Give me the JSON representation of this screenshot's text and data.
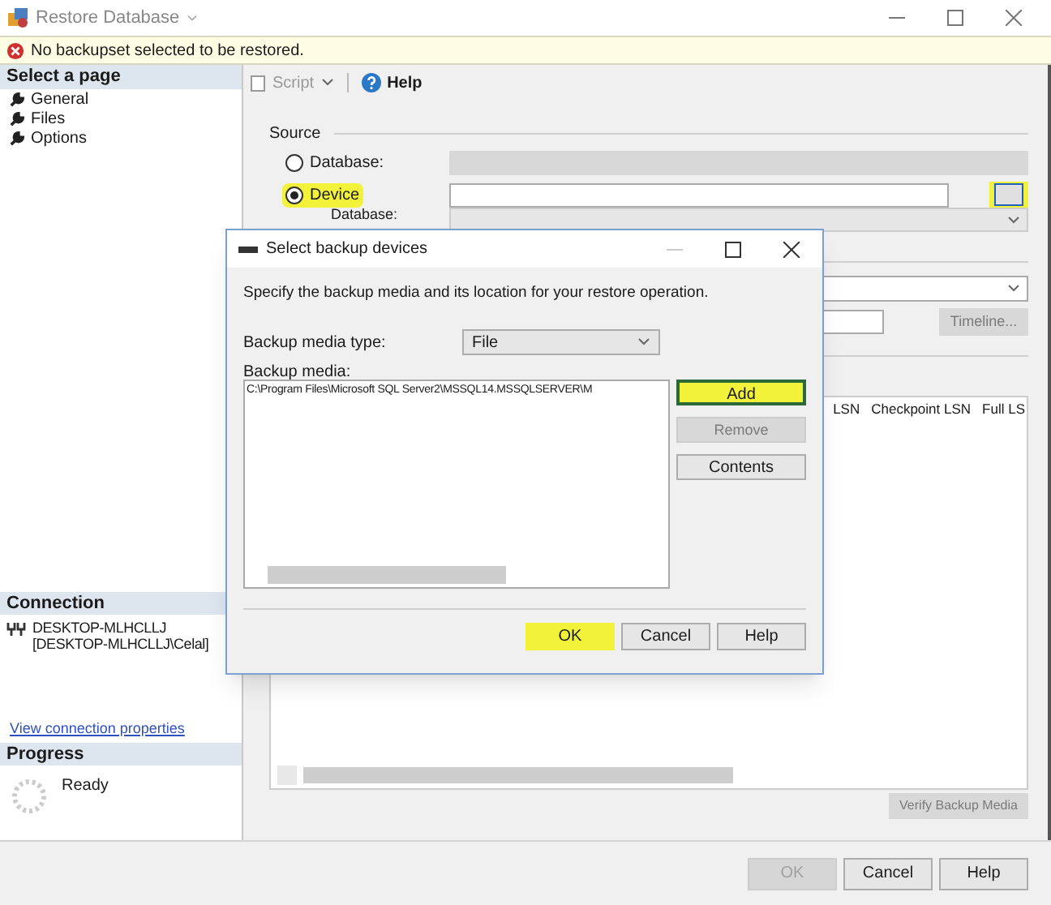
{
  "window": {
    "title": "Restore Database"
  },
  "error": {
    "message": "No backupset selected to be restored."
  },
  "sidebar": {
    "select_page": {
      "header": "Select a page",
      "items": [
        {
          "label": "General"
        },
        {
          "label": "Files"
        },
        {
          "label": "Options"
        }
      ]
    },
    "connection": {
      "header": "Connection",
      "server": "DESKTOP-MLHCLLJ",
      "user": "[DESKTOP-MLHCLLJ\\Celal]",
      "link": "View connection properties"
    },
    "progress": {
      "header": "Progress",
      "status": "Ready"
    }
  },
  "toolbar": {
    "script": "Script",
    "help": "Help"
  },
  "source": {
    "label": "Source",
    "options": [
      {
        "label": "Database:",
        "selected": false,
        "highlighted": false
      },
      {
        "label": "Device",
        "selected": true,
        "highlighted": true
      }
    ],
    "browse_highlighted": true,
    "database_label": "Database:"
  },
  "destination": {
    "timeline": "Timeline..."
  },
  "backup_sets": {
    "columns": [
      "LSN",
      "Checkpoint LSN",
      "Full LS"
    ],
    "verify": "Verify Backup Media"
  },
  "buttons": [
    {
      "label": "OK",
      "disabled": true
    },
    {
      "label": "Cancel",
      "disabled": false
    },
    {
      "label": "Help",
      "disabled": false
    }
  ],
  "dialog": {
    "title": "Select backup devices",
    "description": "Specify the backup media and its location for your restore operation.",
    "media_type_label": "Backup media type:",
    "media_type": "File",
    "media_label": "Backup media:",
    "media": [
      "C:\\Program Files\\Microsoft SQL Server2\\MSSQL14.MSSQLSERVER\\M"
    ],
    "side_buttons": [
      {
        "label": "Add",
        "disabled": false,
        "highlighted": true
      },
      {
        "label": "Remove",
        "disabled": true,
        "highlighted": false
      },
      {
        "label": "Contents",
        "disabled": false,
        "highlighted": false
      }
    ],
    "buttons": [
      {
        "label": "OK",
        "highlighted": true
      },
      {
        "label": "Cancel",
        "highlighted": false
      },
      {
        "label": "Help",
        "highlighted": false
      }
    ]
  }
}
